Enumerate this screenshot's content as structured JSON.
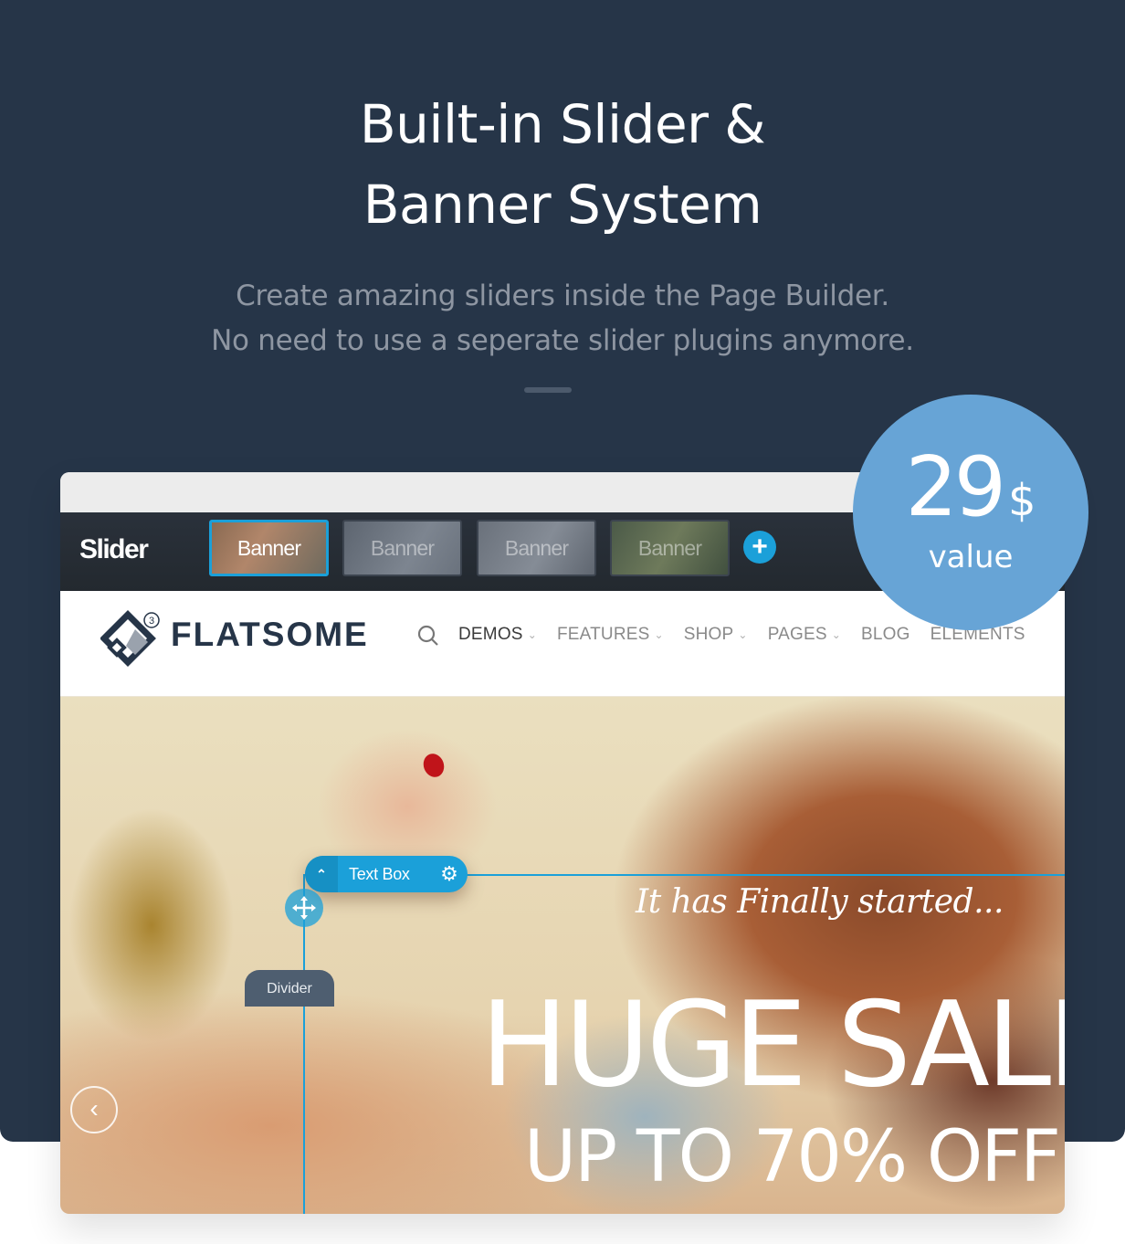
{
  "hero_section": {
    "title_line1": "Built-in Slider &",
    "title_line2": "Banner System",
    "subtitle_line1": "Create amazing sliders inside the Page Builder.",
    "subtitle_line2": "No need to use a seperate slider plugins anymore."
  },
  "badge": {
    "value": "29",
    "currency": "$",
    "label": "value",
    "color": "#67a4d6"
  },
  "slider_toolbar": {
    "label": "Slider",
    "slides": [
      {
        "label": "Banner",
        "active": true
      },
      {
        "label": "Banner",
        "active": false
      },
      {
        "label": "Banner",
        "active": false
      },
      {
        "label": "Banner",
        "active": false
      }
    ],
    "add_icon": "plus-icon",
    "accent": "#1ba0d9"
  },
  "site_header": {
    "logo_text": "FLATSOME",
    "logo_badge": "3",
    "search_icon": "search-icon",
    "nav": [
      {
        "label": "DEMOS",
        "dropdown": true,
        "active": true
      },
      {
        "label": "FEATURES",
        "dropdown": true,
        "active": false
      },
      {
        "label": "SHOP",
        "dropdown": true,
        "active": false
      },
      {
        "label": "PAGES",
        "dropdown": true,
        "active": false
      },
      {
        "label": "BLOG",
        "dropdown": false,
        "active": false
      },
      {
        "label": "ELEMENTS",
        "dropdown": false,
        "active": false
      }
    ]
  },
  "slide": {
    "tagline": "It has Finally started...",
    "headline": "HUGE SALE",
    "subheadline": "UP TO 70% OFF",
    "prev_icon": "chevron-left-icon"
  },
  "builder_overlay": {
    "textbox_label": "Text Box",
    "collapse_icon": "chevron-up-icon",
    "settings_icon": "gear-icon",
    "move_icon": "move-icon",
    "divider_label": "Divider"
  }
}
